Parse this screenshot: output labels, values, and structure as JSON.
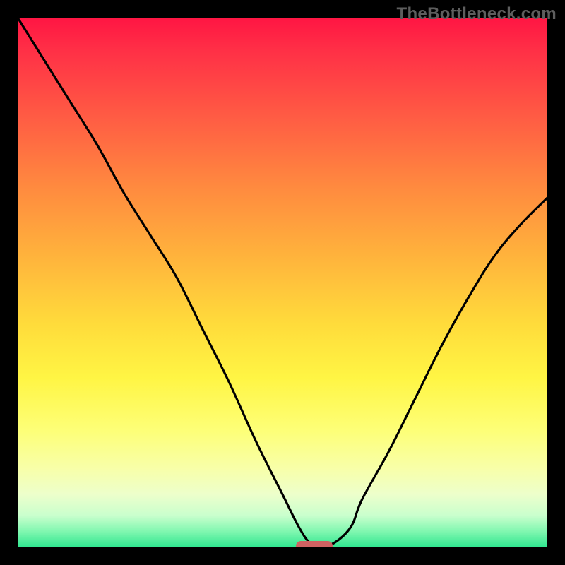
{
  "watermark": "TheBottleneck.com",
  "colors": {
    "frame_bg": "#000000",
    "watermark": "#5e5e5e",
    "curve": "#000000",
    "marker": "#cf6262",
    "gradient_top": "#ff1543",
    "gradient_bottom": "#2ee68f"
  },
  "chart_data": {
    "type": "line",
    "title": "",
    "xlabel": "",
    "ylabel": "",
    "xlim": [
      0,
      100
    ],
    "ylim": [
      0,
      100
    ],
    "grid": false,
    "series": [
      {
        "name": "bottleneck-curve",
        "x": [
          0,
          5,
          10,
          15,
          20,
          25,
          30,
          35,
          40,
          45,
          50,
          53,
          55,
          57,
          60,
          63,
          65,
          70,
          75,
          80,
          85,
          90,
          95,
          100
        ],
        "y": [
          100,
          92,
          84,
          76,
          67,
          59,
          51,
          41,
          31,
          20,
          10,
          4,
          1,
          0,
          1,
          4,
          9,
          18,
          28,
          38,
          47,
          55,
          61,
          66
        ]
      }
    ],
    "annotations": [
      {
        "name": "optimal-marker",
        "x": 56,
        "y": 0,
        "shape": "pill",
        "color": "#cf6262"
      }
    ],
    "legend": false
  }
}
